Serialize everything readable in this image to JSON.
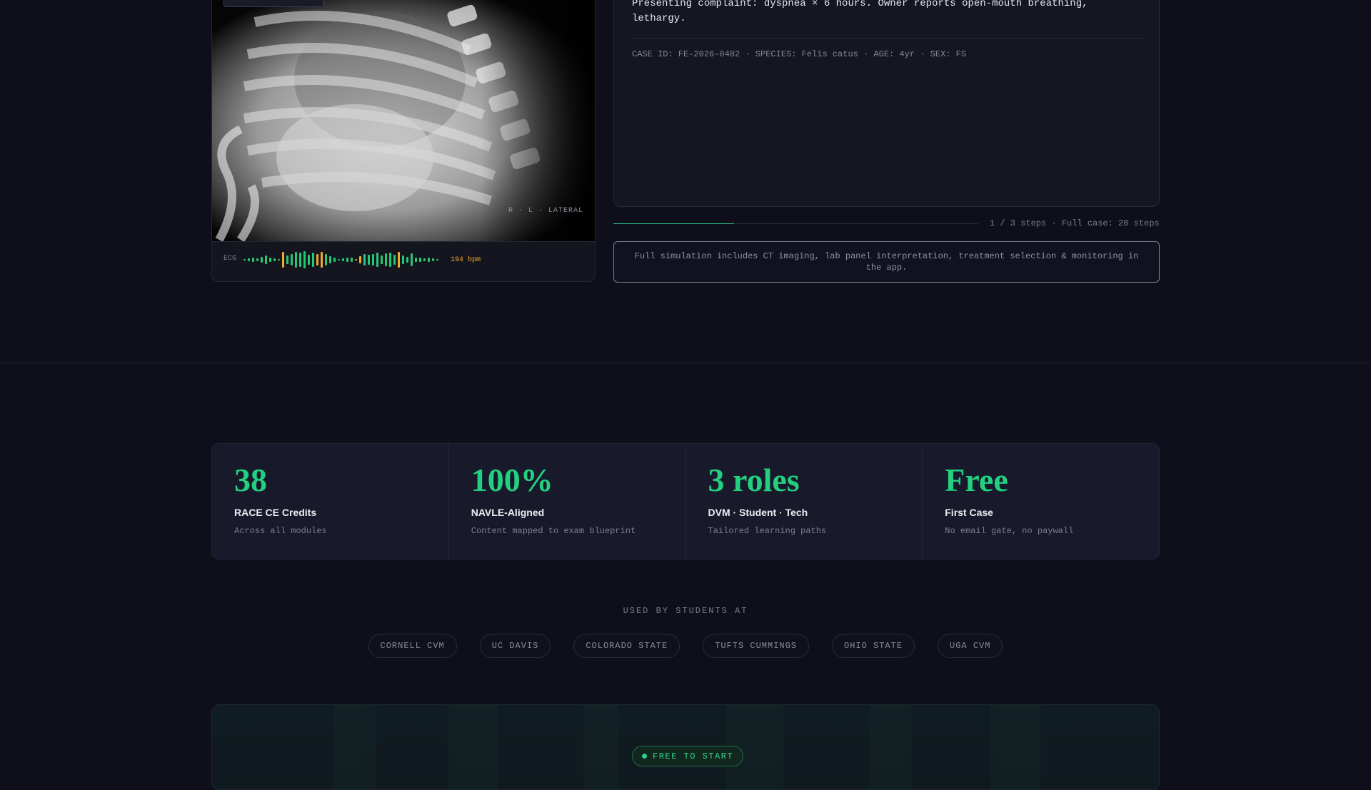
{
  "xray": {
    "view_label": "R · L · LATERAL",
    "ecg_label": "ECG",
    "bpm": "194 bpm",
    "ecg_bars": [
      2,
      4,
      6,
      4,
      8,
      12,
      6,
      4,
      2,
      22,
      12,
      16,
      22,
      20,
      24,
      14,
      20,
      16,
      22,
      16,
      10,
      6,
      2,
      4,
      6,
      6,
      2,
      10,
      16,
      14,
      16,
      20,
      12,
      18,
      20,
      14,
      22,
      12,
      8,
      18,
      6,
      6,
      4,
      6,
      4,
      2
    ],
    "ecg_bar_colors": [
      "#27c774",
      "#27c774",
      "#27c774",
      "#27c774",
      "#27c774",
      "#27c774",
      "#27c774",
      "#27c774",
      "#27c774",
      "#f0a92b",
      "#27c774",
      "#27c774",
      "#27c774",
      "#27c774",
      "#27c774",
      "#27c774",
      "#27c774",
      "#f0a92b",
      "#f0a92b",
      "#27c774",
      "#27c774",
      "#27c774",
      "#27c774",
      "#27c774",
      "#27c774",
      "#27c774",
      "#f0a92b",
      "#f0a92b",
      "#27c774",
      "#27c774",
      "#27c774",
      "#27c774",
      "#27c774",
      "#27c774",
      "#27c774",
      "#27c774",
      "#f0a92b",
      "#27c774",
      "#27c774",
      "#27c774",
      "#27c774",
      "#27c774",
      "#27c774",
      "#27c774",
      "#27c774",
      "#27c774"
    ]
  },
  "case": {
    "complaint": "Presenting complaint: dyspnea × 6 hours. Owner reports open-mouth breathing, lethargy.",
    "meta": "CASE ID: FE-2026-0482 · SPECIES: Felis catus · AGE: 4yr · SEX: FS",
    "progress_fraction": 0.33,
    "progress_text": "1 / 3 steps · Full case: 28 steps",
    "note": "Full simulation includes CT imaging, lab panel interpretation, treatment selection & monitoring in the app."
  },
  "stats": [
    {
      "value": "38",
      "title": "RACE CE Credits",
      "sub": "Across all modules"
    },
    {
      "value": "100%",
      "title": "NAVLE-Aligned",
      "sub": "Content mapped to exam blueprint"
    },
    {
      "value": "3 roles",
      "title": "DVM · Student · Tech",
      "sub": "Tailored learning paths"
    },
    {
      "value": "Free",
      "title": "First Case",
      "sub": "No email gate, no paywall"
    }
  ],
  "schools": {
    "label": "USED BY STUDENTS AT",
    "items": [
      "CORNELL CVM",
      "UC DAVIS",
      "COLORADO STATE",
      "TUFTS CUMMINGS",
      "OHIO STATE",
      "UGA CVM"
    ]
  },
  "cta": {
    "badge": "FREE TO START",
    "accent": "#22d180"
  }
}
